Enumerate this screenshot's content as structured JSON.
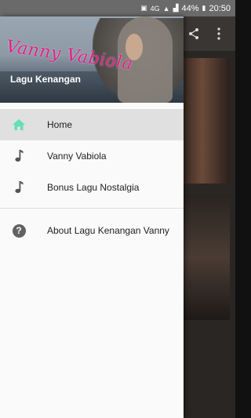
{
  "status_bar": {
    "battery": "44%",
    "time": "20:50",
    "network": "4G"
  },
  "header": {
    "logo_text": "Vanny Vabiola",
    "title": "Lagu Kenangan"
  },
  "menu": {
    "items": [
      {
        "label": "Home",
        "icon": "home-icon",
        "active": true
      },
      {
        "label": "Vanny Vabiola",
        "icon": "music-note-icon"
      },
      {
        "label": "Bonus Lagu Nostalgia",
        "icon": "music-note-icon"
      }
    ],
    "secondary": [
      {
        "label": "About Lagu Kenangan Vanny",
        "icon": "help-icon"
      }
    ]
  },
  "colors": {
    "accent": "#64e0b4",
    "logo": "#e0228a",
    "active_bg": "#e0e0e0"
  }
}
